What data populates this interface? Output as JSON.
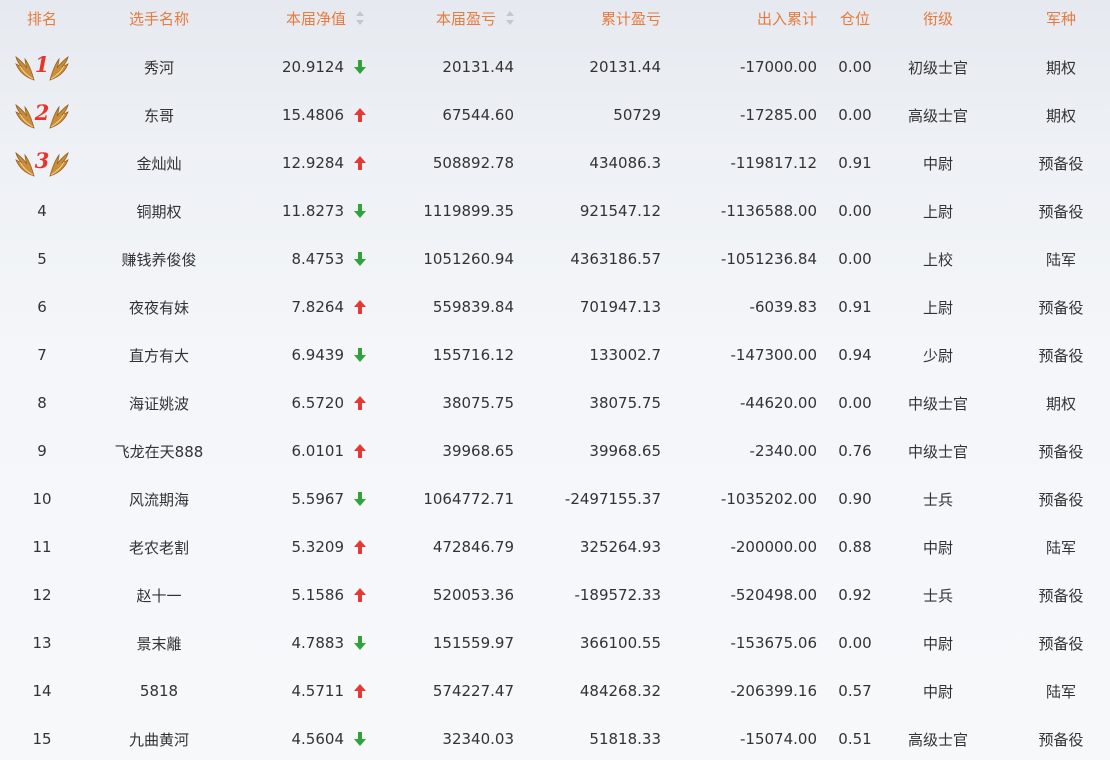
{
  "header": {
    "rank": "排名",
    "name": "选手名称",
    "nav": "本届净值",
    "current_pnl": "本届盈亏",
    "cumulative_pnl": "累计盈亏",
    "in_out": "出入累计",
    "position": "仓位",
    "title": "衔级",
    "branch": "军种"
  },
  "colors": {
    "header_text": "#e57b3f",
    "up_arrow": "#e53935",
    "down_arrow": "#2fa33a",
    "medal_number": "#e8352c"
  },
  "rows": [
    {
      "rank": "1",
      "name": "秀河",
      "nav": "20.9124",
      "trend": "down",
      "current_pnl": "20131.44",
      "cumulative_pnl": "20131.44",
      "in_out": "-17000.00",
      "position": "0.00",
      "title": "初级士官",
      "branch": "期权"
    },
    {
      "rank": "2",
      "name": "东哥",
      "nav": "15.4806",
      "trend": "up",
      "current_pnl": "67544.60",
      "cumulative_pnl": "50729",
      "in_out": "-17285.00",
      "position": "0.00",
      "title": "高级士官",
      "branch": "期权"
    },
    {
      "rank": "3",
      "name": "金灿灿",
      "nav": "12.9284",
      "trend": "up",
      "current_pnl": "508892.78",
      "cumulative_pnl": "434086.3",
      "in_out": "-119817.12",
      "position": "0.91",
      "title": "中尉",
      "branch": "预备役"
    },
    {
      "rank": "4",
      "name": "铜期权",
      "nav": "11.8273",
      "trend": "down",
      "current_pnl": "1119899.35",
      "cumulative_pnl": "921547.12",
      "in_out": "-1136588.00",
      "position": "0.00",
      "title": "上尉",
      "branch": "预备役"
    },
    {
      "rank": "5",
      "name": "赚钱养俊俊",
      "nav": "8.4753",
      "trend": "down",
      "current_pnl": "1051260.94",
      "cumulative_pnl": "4363186.57",
      "in_out": "-1051236.84",
      "position": "0.00",
      "title": "上校",
      "branch": "陆军"
    },
    {
      "rank": "6",
      "name": "夜夜有妹",
      "nav": "7.8264",
      "trend": "up",
      "current_pnl": "559839.84",
      "cumulative_pnl": "701947.13",
      "in_out": "-6039.83",
      "position": "0.91",
      "title": "上尉",
      "branch": "预备役"
    },
    {
      "rank": "7",
      "name": "直方有大",
      "nav": "6.9439",
      "trend": "down",
      "current_pnl": "155716.12",
      "cumulative_pnl": "133002.7",
      "in_out": "-147300.00",
      "position": "0.94",
      "title": "少尉",
      "branch": "预备役"
    },
    {
      "rank": "8",
      "name": "海证姚波",
      "nav": "6.5720",
      "trend": "up",
      "current_pnl": "38075.75",
      "cumulative_pnl": "38075.75",
      "in_out": "-44620.00",
      "position": "0.00",
      "title": "中级士官",
      "branch": "期权"
    },
    {
      "rank": "9",
      "name": "飞龙在天888",
      "nav": "6.0101",
      "trend": "up",
      "current_pnl": "39968.65",
      "cumulative_pnl": "39968.65",
      "in_out": "-2340.00",
      "position": "0.76",
      "title": "中级士官",
      "branch": "预备役"
    },
    {
      "rank": "10",
      "name": "风流期海",
      "nav": "5.5967",
      "trend": "down",
      "current_pnl": "1064772.71",
      "cumulative_pnl": "-2497155.37",
      "in_out": "-1035202.00",
      "position": "0.90",
      "title": "士兵",
      "branch": "预备役"
    },
    {
      "rank": "11",
      "name": "老农老割",
      "nav": "5.3209",
      "trend": "up",
      "current_pnl": "472846.79",
      "cumulative_pnl": "325264.93",
      "in_out": "-200000.00",
      "position": "0.88",
      "title": "中尉",
      "branch": "陆军"
    },
    {
      "rank": "12",
      "name": "赵十一",
      "nav": "5.1586",
      "trend": "up",
      "current_pnl": "520053.36",
      "cumulative_pnl": "-189572.33",
      "in_out": "-520498.00",
      "position": "0.92",
      "title": "士兵",
      "branch": "预备役"
    },
    {
      "rank": "13",
      "name": "景末離",
      "nav": "4.7883",
      "trend": "down",
      "current_pnl": "151559.97",
      "cumulative_pnl": "366100.55",
      "in_out": "-153675.06",
      "position": "0.00",
      "title": "中尉",
      "branch": "预备役"
    },
    {
      "rank": "14",
      "name": "5818",
      "nav": "4.5711",
      "trend": "up",
      "current_pnl": "574227.47",
      "cumulative_pnl": "484268.32",
      "in_out": "-206399.16",
      "position": "0.57",
      "title": "中尉",
      "branch": "陆军"
    },
    {
      "rank": "15",
      "name": "九曲黄河",
      "nav": "4.5604",
      "trend": "down",
      "current_pnl": "32340.03",
      "cumulative_pnl": "51818.33",
      "in_out": "-15074.00",
      "position": "0.51",
      "title": "高级士官",
      "branch": "预备役"
    }
  ]
}
